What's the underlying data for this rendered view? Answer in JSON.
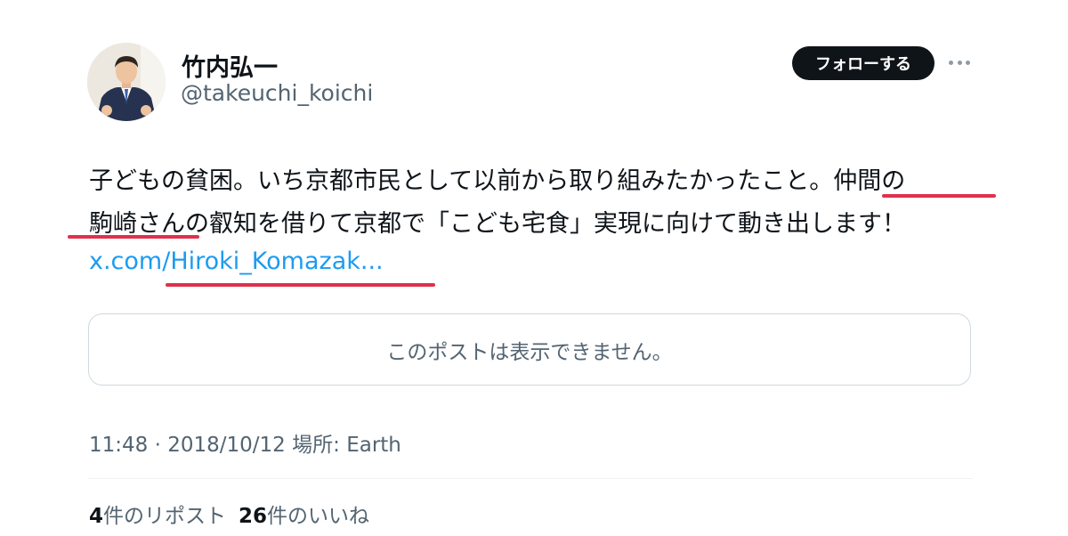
{
  "author": {
    "display_name": "竹内弘一",
    "handle": "@takeuchi_koichi",
    "follow_label": "フォローする"
  },
  "tweet": {
    "line1": "子どもの貧困。いち京都市民として以前から取り組みたかったこと。仲間の",
    "line2": "駒崎さんの叡知を借りて京都で「こども宅食」実現に向けて動き出します！",
    "link": "x.com/Hiroki_Komazak..."
  },
  "quote": {
    "unavailable_text": "このポストは表示できません。"
  },
  "meta": {
    "time": "11:48",
    "separator": "·",
    "date": "2018/10/12",
    "location_label": "場所:",
    "location": "Earth"
  },
  "stats": {
    "reposts_count": "4",
    "reposts_label": "件のリポスト",
    "likes_count": "26",
    "likes_label": "件のいいね"
  },
  "colors": {
    "link": "#1d9bf0",
    "annotation_underline": "#e0314b",
    "follow_button": "#0f1419",
    "secondary_text": "#536471"
  }
}
